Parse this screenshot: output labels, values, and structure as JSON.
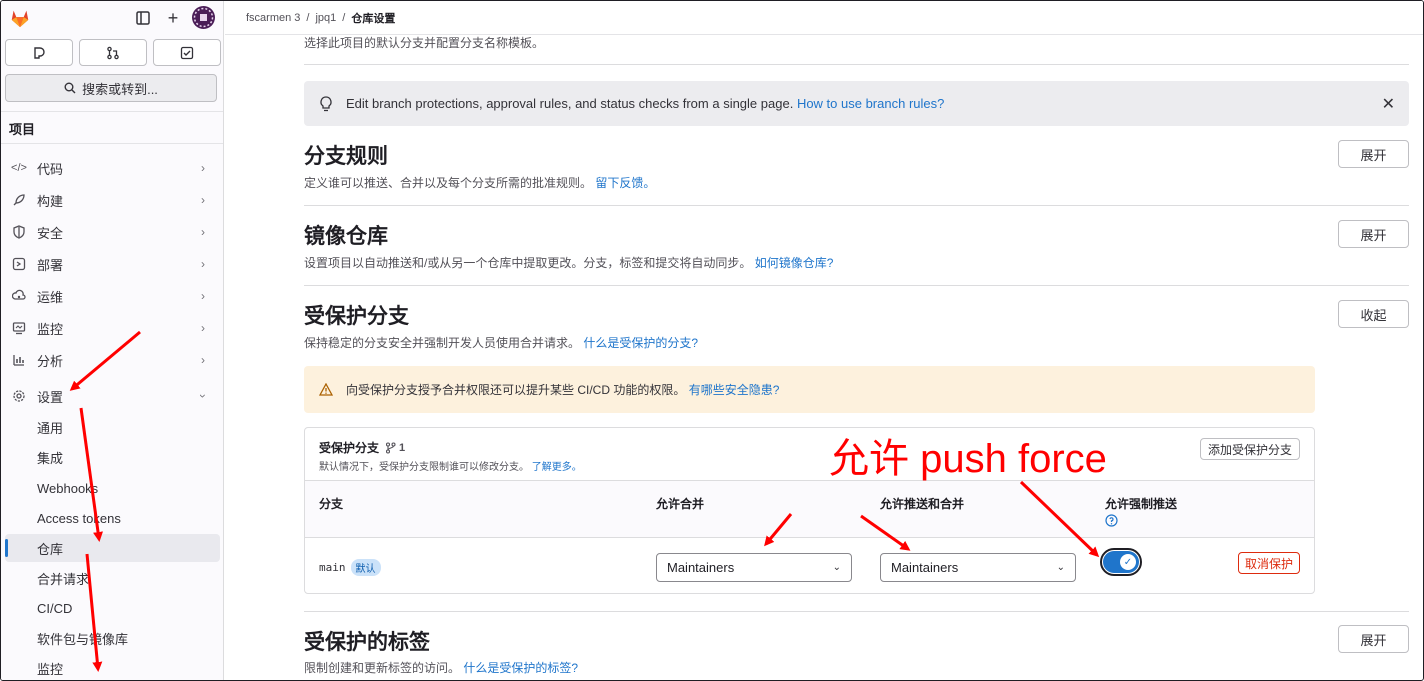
{
  "sidebar": {
    "search_label": "搜索或转到...",
    "heading": "项目",
    "items": [
      {
        "label": "代码",
        "icon": "code-icon"
      },
      {
        "label": "构建",
        "icon": "rocket-icon"
      },
      {
        "label": "安全",
        "icon": "shield-icon"
      },
      {
        "label": "部署",
        "icon": "deploy-icon"
      },
      {
        "label": "运维",
        "icon": "cloud-icon"
      },
      {
        "label": "监控",
        "icon": "monitor-icon"
      },
      {
        "label": "分析",
        "icon": "chart-icon"
      },
      {
        "label": "设置",
        "icon": "gear-icon"
      }
    ],
    "settings_sub": [
      "通用",
      "集成",
      "Webhooks",
      "Access tokens",
      "仓库",
      "合并请求",
      "CI/CD",
      "软件包与镜像库",
      "监控"
    ],
    "active_sub": "仓库"
  },
  "breadcrumb": {
    "items": [
      "fscarmen 3",
      "jpq1",
      "仓库设置"
    ],
    "sep": "/"
  },
  "main": {
    "cut_text": "选择此项目的默认分支并配置分支名称模板。",
    "info_banner": {
      "text": "Edit branch protections, approval rules, and status checks from a single page.",
      "link": "How to use branch rules?"
    },
    "sections": {
      "branch_rules": {
        "title": "分支规则",
        "desc": "定义谁可以推送、合并以及每个分支所需的批准规则。",
        "link": "留下反馈。",
        "button": "展开"
      },
      "mirror": {
        "title": "镜像仓库",
        "desc": "设置项目以自动推送和/或从另一个仓库中提取更改。分支，标签和提交将自动同步。",
        "link": "如何镜像仓库?",
        "button": "展开"
      },
      "protected": {
        "title": "受保护分支",
        "desc": "保持稳定的分支安全并强制开发人员使用合并请求。",
        "link": "什么是受保护的分支?",
        "button": "收起"
      },
      "tags": {
        "title": "受保护的标签",
        "desc": "限制创建和更新标签的访问。",
        "link": "什么是受保护的标签?",
        "button": "展开"
      }
    },
    "warning": {
      "text": "向受保护分支授予合并权限还可以提升某些 CI/CD 功能的权限。",
      "link": "有哪些安全隐患?"
    },
    "card": {
      "title": "受保护分支",
      "count": "1",
      "subtitle": "默认情况下，受保护分支限制谁可以修改分支。",
      "subtitle_link": "了解更多。",
      "add_button": "添加受保护分支",
      "columns": {
        "branch": "分支",
        "merge": "允许合并",
        "push_merge": "允许推送和合并",
        "force_push": "允许强制推送"
      },
      "row": {
        "branch": "main",
        "badge": "默认",
        "merge_value": "Maintainers",
        "push_value": "Maintainers",
        "force_push": true,
        "unprotect": "取消保护"
      }
    }
  },
  "annotation": {
    "text": "允许 push force",
    "color": "#ff0000"
  },
  "colors": {
    "accent": "#1f75cb",
    "danger": "#dd2b0e",
    "warning_bg": "#fdf1dd",
    "annotation": "#ff0000"
  }
}
